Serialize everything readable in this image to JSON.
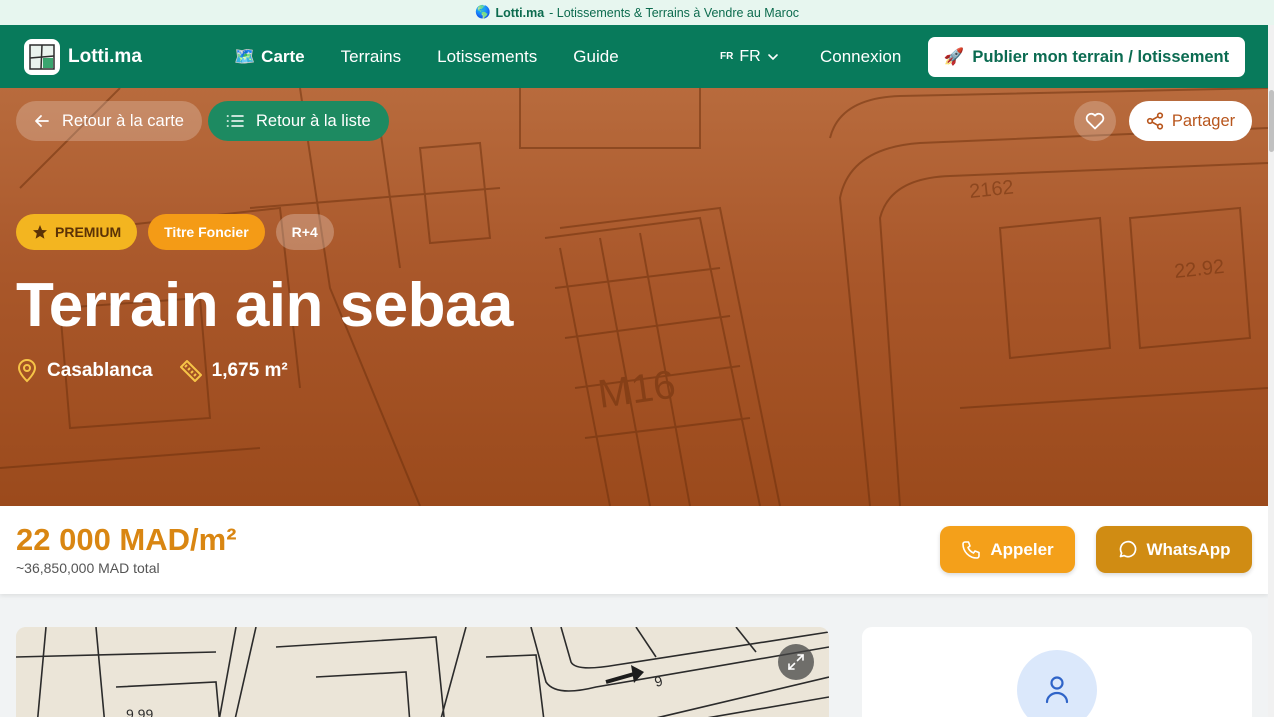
{
  "banner": {
    "icon": "globe-icon",
    "brand": "Lotti.ma",
    "text": "- Lotissements & Terrains à Vendre au Maroc"
  },
  "nav": {
    "brand": "Lotti.ma",
    "links": [
      {
        "label": "Carte",
        "icon": "map-icon",
        "active": true
      },
      {
        "label": "Terrains"
      },
      {
        "label": "Lotissements"
      },
      {
        "label": "Guide"
      }
    ],
    "lang_code": "FR",
    "lang_label": "FR",
    "login": "Connexion",
    "publish": "Publier mon terrain / lotissement",
    "publish_icon": "rocket-icon"
  },
  "hero": {
    "back_map": "Retour à la carte",
    "back_list": "Retour à la liste",
    "share": "Partager",
    "badges": {
      "premium": "PREMIUM",
      "titre": "Titre Foncier",
      "floors": "R+4"
    },
    "title": "Terrain ain sebaa",
    "city": "Casablanca",
    "area": "1,675 m²"
  },
  "pricing": {
    "price": "22 000 MAD/m²",
    "total": "~36,850,000 MAD total",
    "call": "Appeler",
    "whatsapp": "WhatsApp"
  },
  "colors": {
    "primary": "#087a5b",
    "accent": "#f4a01a",
    "price": "#d98612",
    "hero": "#a9572a"
  }
}
